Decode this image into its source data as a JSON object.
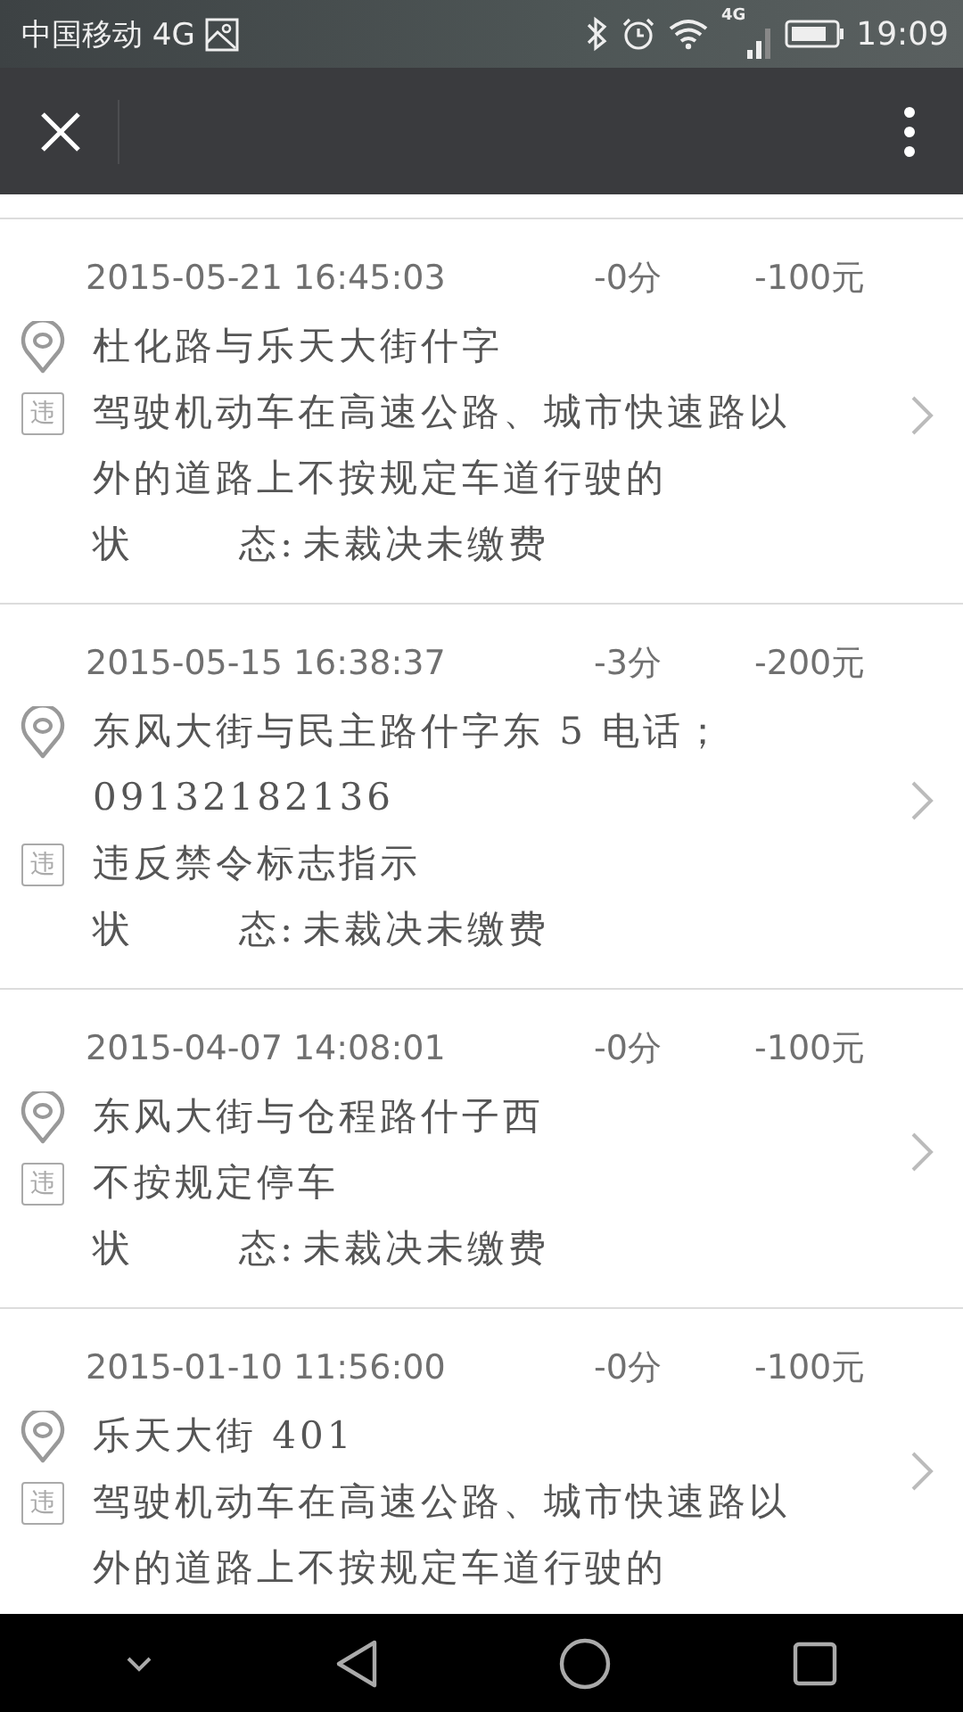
{
  "status_bar": {
    "carrier": "中国移动 4G",
    "network": "4G",
    "time": "19:09"
  },
  "records": [
    {
      "date": "2015-05-21 16:45:03",
      "points": "-0分",
      "fine": "-100元",
      "location": [
        "杜化路与乐天大街什字"
      ],
      "badge": "违",
      "violation": [
        "驾驶机动车在高速公路、城市快速路以",
        "外的道路上不按规定车道行驶的"
      ],
      "status": {
        "label": [
          "状",
          "态:"
        ],
        "value": "未裁决未缴费"
      }
    },
    {
      "date": "2015-05-15 16:38:37",
      "points": "-3分",
      "fine": "-200元",
      "location": [
        "东风大街与民主路什字东 5 电话；",
        "09132182136"
      ],
      "badge": "违",
      "violation": [
        "违反禁令标志指示"
      ],
      "status": {
        "label": [
          "状",
          "态:"
        ],
        "value": "未裁决未缴费"
      }
    },
    {
      "date": "2015-04-07 14:08:01",
      "points": "-0分",
      "fine": "-100元",
      "location": [
        "东风大街与仓程路什子西"
      ],
      "badge": "违",
      "violation": [
        "不按规定停车"
      ],
      "status": {
        "label": [
          "状",
          "态:"
        ],
        "value": "未裁决未缴费"
      }
    },
    {
      "date": "2015-01-10 11:56:00",
      "points": "-0分",
      "fine": "-100元",
      "location": [
        "乐天大街 401"
      ],
      "badge": "违",
      "violation": [
        "驾驶机动车在高速公路、城市快速路以",
        "外的道路上不按规定车道行驶的"
      ]
    }
  ]
}
